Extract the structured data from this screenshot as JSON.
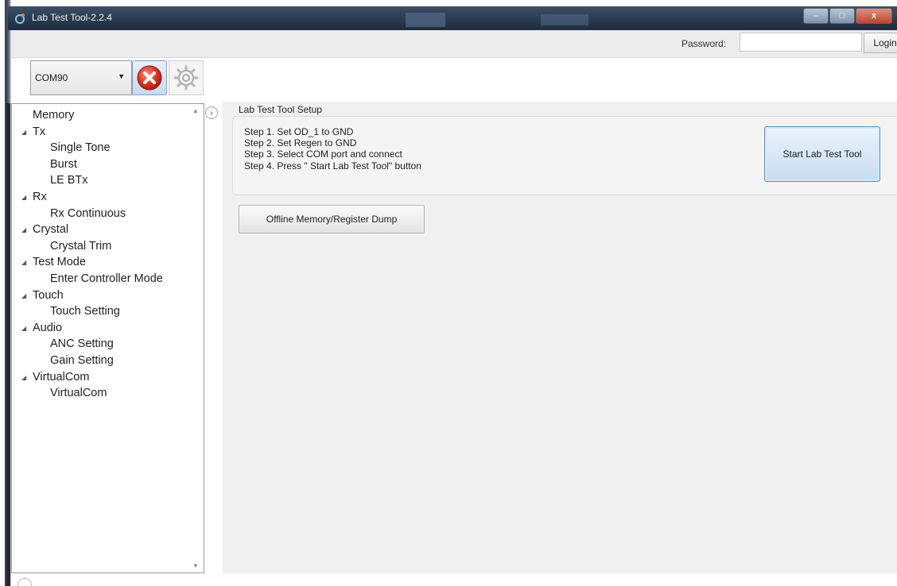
{
  "window": {
    "title": "Lab Test Tool-2.2.4",
    "minimize_glyph": "–",
    "maximize_glyph": "□",
    "close_glyph": "x"
  },
  "auth": {
    "password_label": "Password:",
    "password_value": "",
    "login_label": "Login"
  },
  "toolbar": {
    "com_port": "COM90",
    "disconnect_icon": "red-circle-x-icon",
    "settings_icon": "gear-icon"
  },
  "sidebar": {
    "scroll_up_glyph": "▲",
    "scroll_down_glyph": "▼",
    "expand_glyph": "›",
    "tree_glyph": "◢",
    "items": [
      {
        "label": "Memory",
        "level": "root"
      },
      {
        "label": "Tx",
        "level": "parent"
      },
      {
        "label": "Single Tone",
        "level": "child"
      },
      {
        "label": "Burst",
        "level": "child"
      },
      {
        "label": "LE BTx",
        "level": "child"
      },
      {
        "label": "Rx",
        "level": "parent"
      },
      {
        "label": "Rx Continuous",
        "level": "child"
      },
      {
        "label": "Crystal",
        "level": "parent"
      },
      {
        "label": "Crystal Trim",
        "level": "child"
      },
      {
        "label": "Test Mode",
        "level": "parent"
      },
      {
        "label": "Enter Controller Mode",
        "level": "child"
      },
      {
        "label": "Touch",
        "level": "parent"
      },
      {
        "label": "Touch Setting",
        "level": "child"
      },
      {
        "label": "Audio",
        "level": "parent"
      },
      {
        "label": "ANC Setting",
        "level": "child"
      },
      {
        "label": "Gain Setting",
        "level": "child"
      },
      {
        "label": "VirtualCom",
        "level": "parent"
      },
      {
        "label": "VirtualCom",
        "level": "child"
      }
    ]
  },
  "setup": {
    "group_title": "Lab Test Tool Setup",
    "steps": [
      "Step 1. Set OD_1 to GND",
      "Step 2. Set Regen to GND",
      "Step 3. Select COM port and connect",
      "Step 4. Press \" Start Lab Test Tool\" button"
    ],
    "start_button": "Start Lab Test Tool",
    "offline_button": "Offline Memory/Register Dump"
  }
}
